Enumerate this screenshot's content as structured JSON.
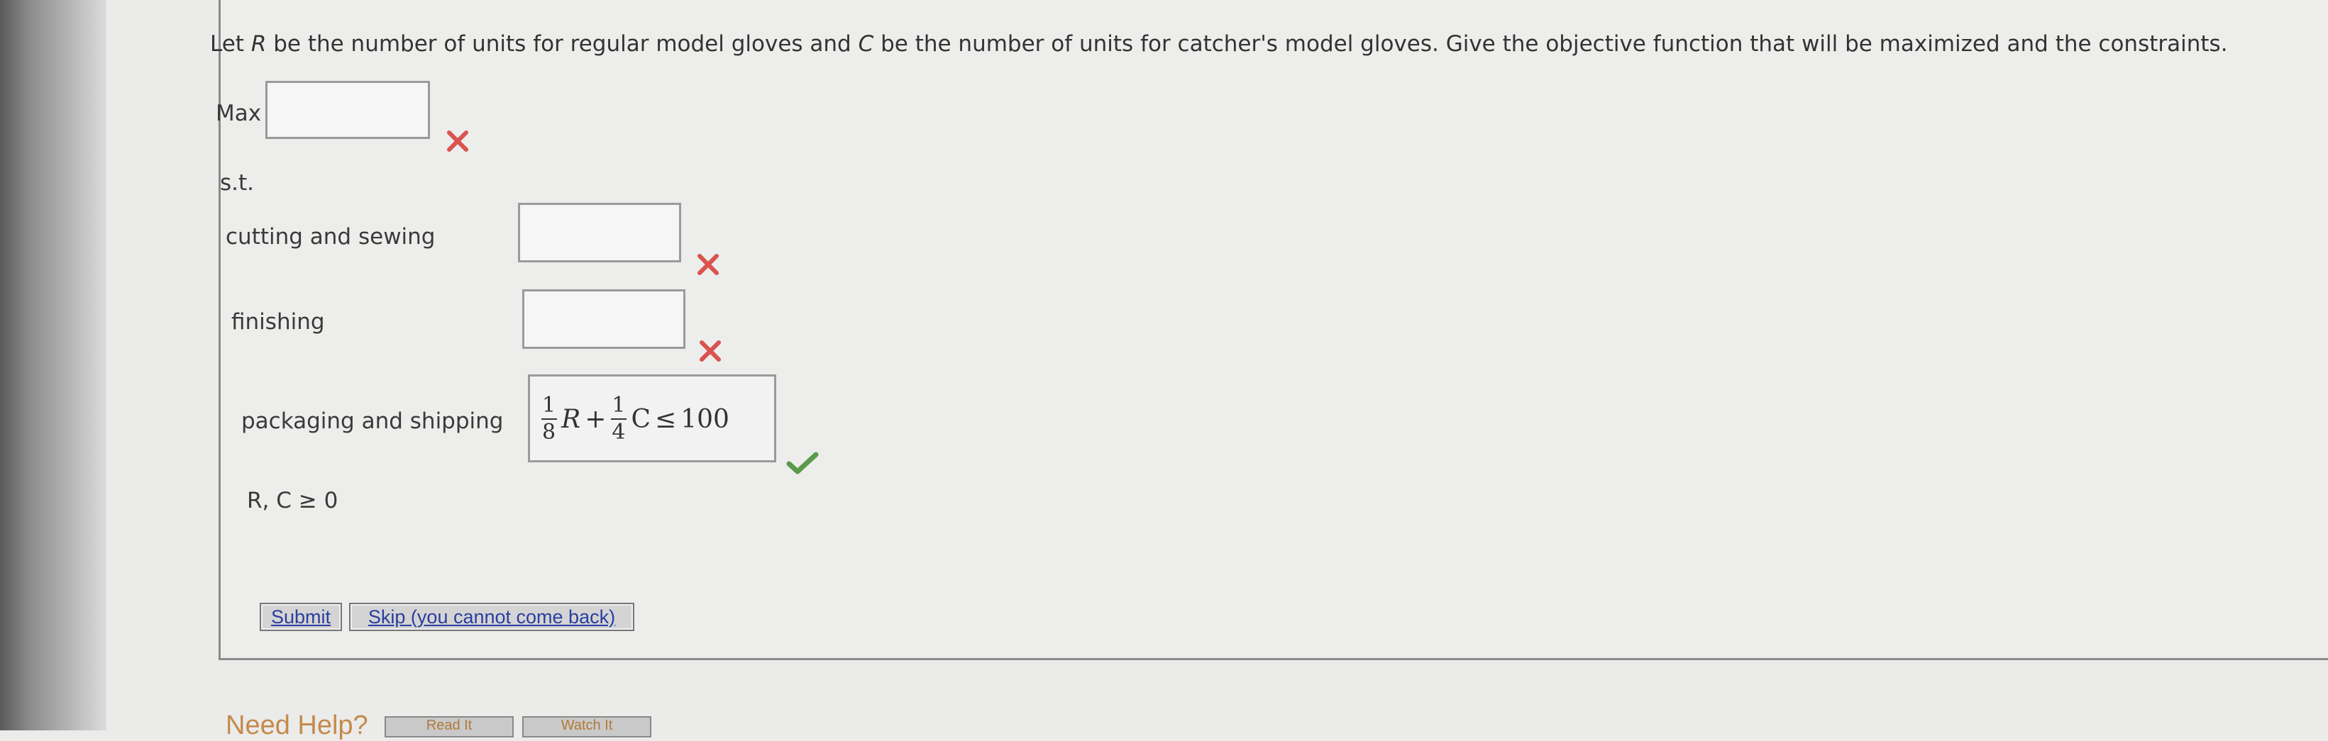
{
  "question": {
    "prefix": "Let ",
    "var_r": "R",
    "middle": " be the number of units for regular model gloves and ",
    "var_c": "C",
    "suffix": " be the number of units for catcher's model gloves. Give the objective function that will be maximized and the constraints."
  },
  "objective": {
    "label": "Max",
    "value": "",
    "status": "incorrect"
  },
  "subject_to": "s.t.",
  "constraints": [
    {
      "label": "cutting and sewing",
      "value": "",
      "status": "incorrect"
    },
    {
      "label": "finishing",
      "value": "",
      "status": "incorrect"
    },
    {
      "label": "packaging and shipping",
      "status": "correct",
      "expr": {
        "frac1_num": "1",
        "frac1_den": "8",
        "var1": "R",
        "op": "+",
        "frac2_num": "1",
        "frac2_den": "4",
        "var2": "C",
        "rel": "≤",
        "rhs": "100"
      }
    }
  ],
  "nonnegativity": "R, C ≥ 0",
  "buttons": {
    "submit": "Submit",
    "skip": "Skip (you cannot come back)"
  },
  "help": {
    "title": "Need Help?",
    "read": "Read It",
    "watch": "Watch It"
  },
  "colors": {
    "incorrect": "#d9534f",
    "correct": "#5a9a4a",
    "link": "#2a3ea0"
  }
}
